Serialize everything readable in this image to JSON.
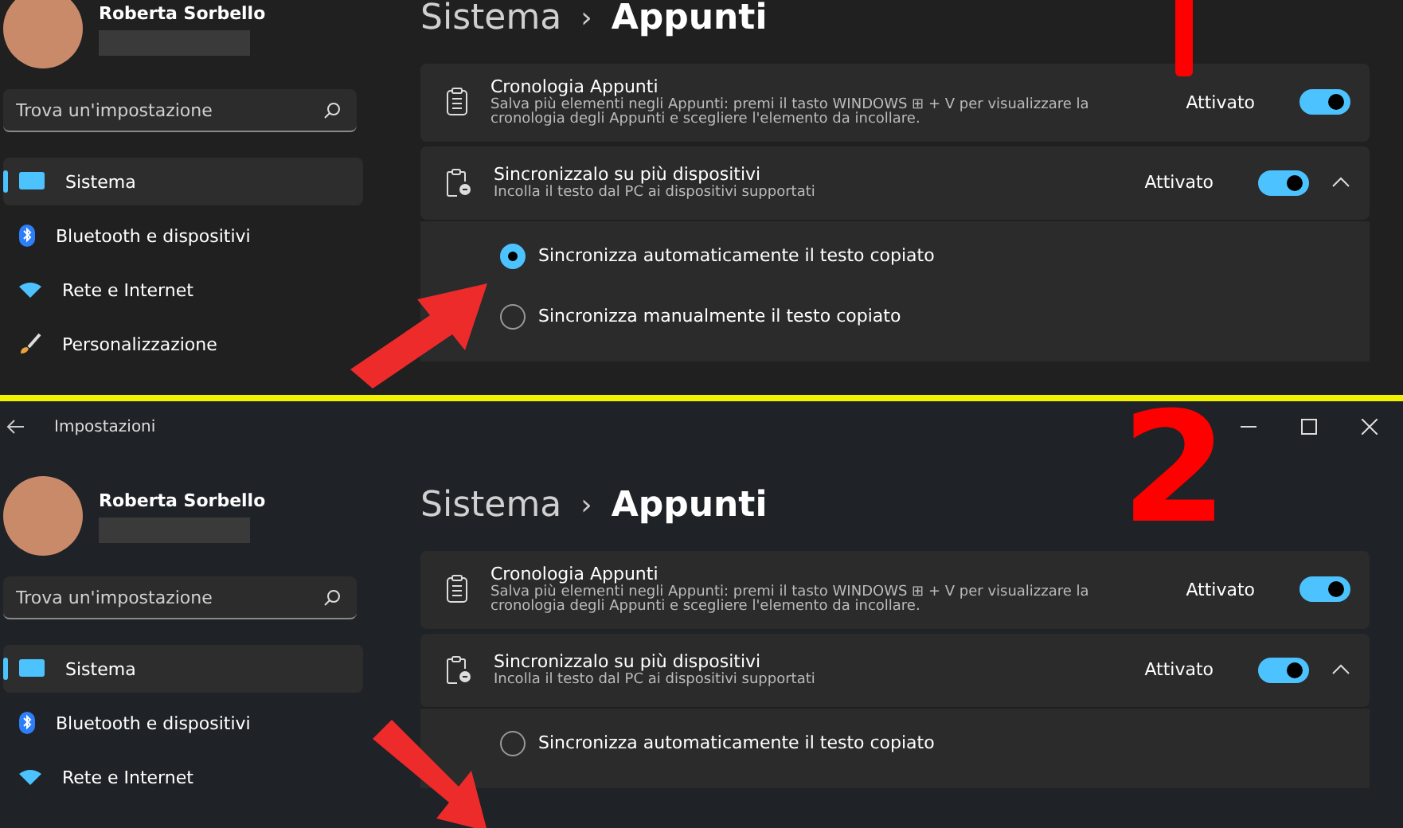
{
  "panels": [
    {
      "user": {
        "name": "Roberta Sorbello"
      },
      "search": {
        "placeholder": "Trova un'impostazione"
      },
      "nav": [
        {
          "label": "Sistema",
          "selected": true
        },
        {
          "label": "Bluetooth e dispositivi",
          "selected": false
        },
        {
          "label": "Rete e Internet",
          "selected": false
        },
        {
          "label": "Personalizzazione",
          "selected": false
        }
      ],
      "breadcrumb": {
        "parent": "Sistema",
        "separator": "›",
        "current": "Appunti"
      },
      "cards": [
        {
          "title": "Cronologia Appunti",
          "description": "Salva più elementi negli Appunti: premi il tasto WINDOWS ⊞ + V per visualizzare la cronologia degli Appunti e scegliere l'elemento da incollare.",
          "state_label": "Attivato",
          "on": true
        },
        {
          "title": "Sincronizzalo su più dispositivi",
          "description": "Incolla il testo dal PC ai dispositivi supportati",
          "state_label": "Attivato",
          "on": true,
          "expanded": true,
          "options": [
            {
              "label": "Sincronizza automaticamente il testo copiato",
              "selected": true
            },
            {
              "label": "Sincronizza manualmente il testo copiato",
              "selected": false
            }
          ]
        }
      ],
      "annotations": [
        {
          "kind": "bar"
        },
        {
          "kind": "arrow-up"
        }
      ]
    },
    {
      "title_bar": {
        "title": "Impostazioni"
      },
      "user": {
        "name": "Roberta Sorbello"
      },
      "search": {
        "placeholder": "Trova un'impostazione"
      },
      "nav": [
        {
          "label": "Sistema",
          "selected": true
        },
        {
          "label": "Bluetooth e dispositivi",
          "selected": false
        },
        {
          "label": "Rete e Internet",
          "selected": false
        }
      ],
      "breadcrumb": {
        "parent": "Sistema",
        "separator": "›",
        "current": "Appunti"
      },
      "cards": [
        {
          "title": "Cronologia Appunti",
          "description": "Salva più elementi negli Appunti: premi il tasto WINDOWS ⊞ + V per visualizzare la cronologia degli Appunti e scegliere l'elemento da incollare.",
          "state_label": "Attivato",
          "on": true
        },
        {
          "title": "Sincronizzalo su più dispositivi",
          "description": "Incolla il testo dal PC ai dispositivi supportati",
          "state_label": "Attivato",
          "on": true,
          "expanded": true,
          "options": [
            {
              "label": "Sincronizza automaticamente il testo copiato",
              "selected": false
            }
          ]
        }
      ],
      "annotations": [
        {
          "kind": "number",
          "text": "2"
        },
        {
          "kind": "arrow-down"
        }
      ]
    }
  ]
}
